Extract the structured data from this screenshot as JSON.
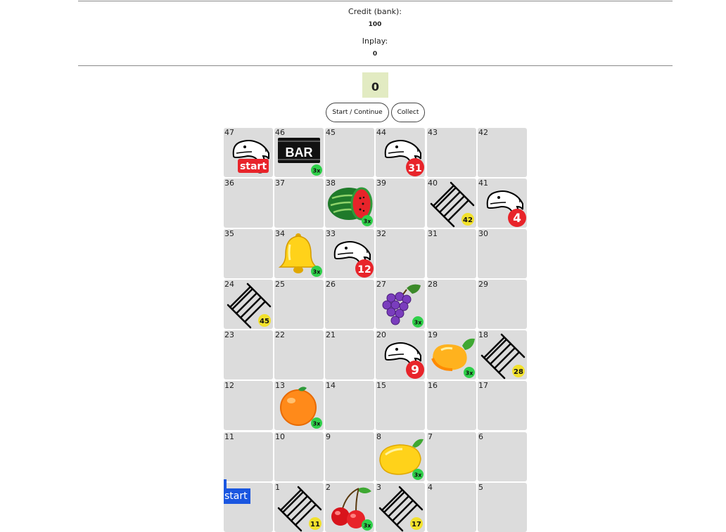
{
  "credit": {
    "label": "Credit (bank):",
    "value": "100"
  },
  "inplay": {
    "label": "Inplay:",
    "value": "0"
  },
  "counter": "0",
  "buttons": {
    "start": "Start / Continue",
    "collect": "Collect"
  },
  "start_marker": "start",
  "cells": [
    {
      "n": "47",
      "icon": "snake",
      "badge": "start"
    },
    {
      "n": "46",
      "icon": "bar",
      "badge": "3x"
    },
    {
      "n": "45"
    },
    {
      "n": "44",
      "icon": "snake",
      "badge": "31"
    },
    {
      "n": "43"
    },
    {
      "n": "42"
    },
    {
      "n": "36"
    },
    {
      "n": "37"
    },
    {
      "n": "38",
      "icon": "watermelon",
      "badge": "3x"
    },
    {
      "n": "39"
    },
    {
      "n": "40",
      "icon": "ladder",
      "badge": "42"
    },
    {
      "n": "41",
      "icon": "snake",
      "badge": "4"
    },
    {
      "n": "35"
    },
    {
      "n": "34",
      "icon": "bell",
      "badge": "3x"
    },
    {
      "n": "33",
      "icon": "snake",
      "badge": "12"
    },
    {
      "n": "32"
    },
    {
      "n": "31"
    },
    {
      "n": "30"
    },
    {
      "n": "24",
      "icon": "ladder",
      "badge": "45"
    },
    {
      "n": "25"
    },
    {
      "n": "26"
    },
    {
      "n": "27",
      "icon": "grapes",
      "badge": "3x"
    },
    {
      "n": "28"
    },
    {
      "n": "29"
    },
    {
      "n": "23"
    },
    {
      "n": "22"
    },
    {
      "n": "21"
    },
    {
      "n": "20",
      "icon": "snake",
      "badge": "9"
    },
    {
      "n": "19",
      "icon": "mango",
      "badge": "3x"
    },
    {
      "n": "18",
      "icon": "ladder",
      "badge": "28"
    },
    {
      "n": "12"
    },
    {
      "n": "13",
      "icon": "orange",
      "badge": "3x"
    },
    {
      "n": "14"
    },
    {
      "n": "15"
    },
    {
      "n": "16"
    },
    {
      "n": "17"
    },
    {
      "n": "11"
    },
    {
      "n": "10"
    },
    {
      "n": "9"
    },
    {
      "n": "8",
      "icon": "lemon",
      "badge": "3x"
    },
    {
      "n": "7"
    },
    {
      "n": "6"
    },
    {
      "n": ""
    },
    {
      "n": "1",
      "icon": "ladder",
      "badge": "11"
    },
    {
      "n": "2",
      "icon": "cherry",
      "badge": "3x"
    },
    {
      "n": "3",
      "icon": "ladder",
      "badge": "17"
    },
    {
      "n": "4"
    },
    {
      "n": "5"
    }
  ],
  "colors": {
    "tile": "#dcdcdc",
    "counter_bg": "#e2ebc2",
    "start_blue": "#1a56e0",
    "snake_badge": "#e8242a",
    "ladder_badge": "#f2e12c",
    "multiplier_badge": "#2fd04a"
  }
}
